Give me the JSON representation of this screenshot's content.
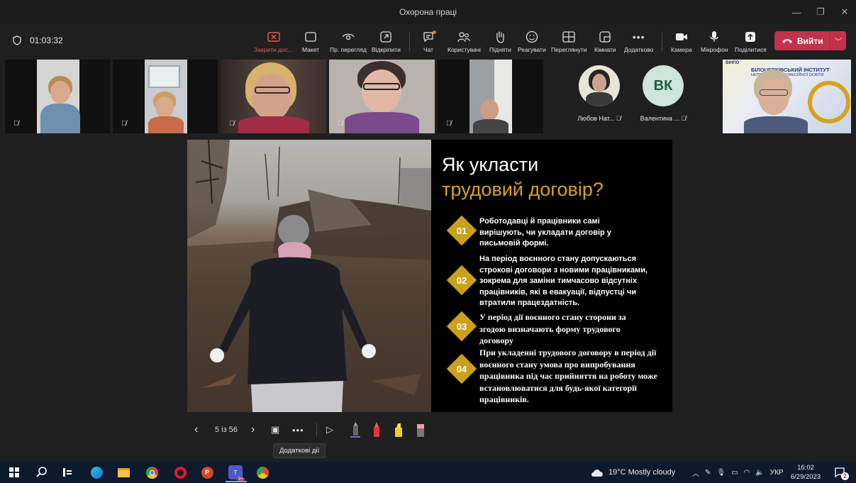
{
  "window": {
    "title": "Охорона праці"
  },
  "meeting": {
    "elapsed": "01:03:32"
  },
  "toolbar": {
    "stop_share": "Закрити дос...",
    "layout": "Макет",
    "view": "Пр. перегляд",
    "popout": "Відкріпити",
    "chat": "Чат",
    "people": "Користувачі",
    "raise": "Підняти",
    "react": "Реагувати",
    "view_mode": "Переглянути",
    "rooms": "Кімнати",
    "more": "Додатково",
    "camera": "Камера",
    "mic": "Мікрофон",
    "share": "Поділитися",
    "leave": "Вийти"
  },
  "participants": {
    "avatar1_name": "Любов Нат...",
    "avatar2_name": "Валентина ...",
    "avatar2_initials": "ВК"
  },
  "shared_logo": {
    "line1": "ВІНПО",
    "line2": "БІЛОЦЕРКІВСЬКИЙ ІНСТИТУТ",
    "line3": "НЕПЕРЕРВНОЇ ПРОФЕСІЙНОЇ ОСВІТИ"
  },
  "slide": {
    "title_line1": "Як укласти",
    "title_line2": "трудовий договір?",
    "points": [
      {
        "num": "01",
        "text": "Роботодавці й працівники самі вирішують, чи укладати договір у письмовій формі."
      },
      {
        "num": "02",
        "text": "На період воєнного стану допускаються строкові договори з новими працівниками, зокрема для заміни тимчасово відсутніх працівників, які в евакуації, відпустці чи втратили працездатність."
      },
      {
        "num": "03",
        "text": "У період дії воєнного стану сторони за згодою визначають форму трудового договору"
      },
      {
        "num": "04",
        "text": "При укладенні трудового договору в період дії воєнного стану умова про випробування працівника під час прийняття на роботу може встановлюватися для будь-якої категорії працівників."
      }
    ]
  },
  "presenter": {
    "page": "5 із 56",
    "tooltip": "Додаткові дії"
  },
  "taskbar": {
    "weather": "19°C  Mostly cloudy",
    "lang": "УКР",
    "time": "16:02",
    "date": "6/29/2023",
    "notif_count": "2"
  },
  "colors": {
    "accent_gold": "#c9a21c",
    "leave_red": "#c4314b",
    "share_red": "#e65c5c"
  }
}
